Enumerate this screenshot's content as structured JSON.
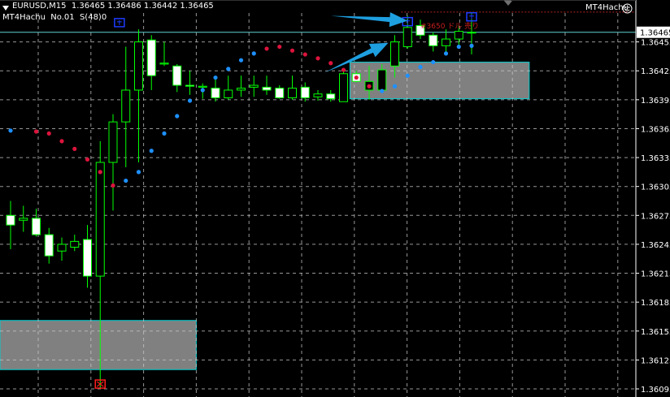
{
  "header": {
    "symbol_line": "EURUSD,M15  1.36465 1.36486 1.36442 1.36465",
    "indicator_line": "MT4Hachu  No.01  S(48)0",
    "ea_label": "MT4Hachu",
    "smiley_icon": "smiley-icon",
    "dropdown_icon": "triangle-down-icon"
  },
  "order_annotation": "#3650 ドル 売り",
  "colors": {
    "background": "#000000",
    "grid": "#c8c8c8",
    "axis": "#ffffff",
    "bull_candle": "#000000",
    "bear_candle": "#ffffff",
    "candle_outline": "#00ff00",
    "sar_up": "#1e90ff",
    "sar_down": "#dc143c",
    "zone_fill": "#808080",
    "zone_border": "#00ced1",
    "arrow": "#1e9fe0",
    "price_line": "#5fd3d3",
    "marker_blue": "#1e3cff",
    "marker_red": "#ff1e1e",
    "price_tag_bg": "#ffffff"
  },
  "chart_data": {
    "type": "candlestick",
    "title": "EURUSD,M15",
    "ylim": [
      1.36095,
      1.36485
    ],
    "grid": true,
    "yticks": [
      "1.36095",
      "1.36125",
      "1.36155",
      "1.36185",
      "1.36215",
      "1.36245",
      "1.36275",
      "1.36305",
      "1.36335",
      "1.36365",
      "1.36395",
      "1.36425",
      "1.36455"
    ],
    "current_price": "1.36465",
    "candles": [
      {
        "o": 1.36275,
        "h": 1.3629,
        "l": 1.3624,
        "c": 1.36265
      },
      {
        "o": 1.3627,
        "h": 1.36285,
        "l": 1.36258,
        "c": 1.36272
      },
      {
        "o": 1.36272,
        "h": 1.36282,
        "l": 1.36253,
        "c": 1.36255
      },
      {
        "o": 1.36255,
        "h": 1.36262,
        "l": 1.36225,
        "c": 1.36233
      },
      {
        "o": 1.36238,
        "h": 1.36252,
        "l": 1.36228,
        "c": 1.36245
      },
      {
        "o": 1.36242,
        "h": 1.36255,
        "l": 1.36238,
        "c": 1.36248
      },
      {
        "o": 1.3625,
        "h": 1.36265,
        "l": 1.362,
        "c": 1.36212
      },
      {
        "o": 1.36212,
        "h": 1.36352,
        "l": 1.36095,
        "c": 1.3633
      },
      {
        "o": 1.3633,
        "h": 1.3638,
        "l": 1.3628,
        "c": 1.36372
      },
      {
        "o": 1.36372,
        "h": 1.3645,
        "l": 1.36325,
        "c": 1.36405
      },
      {
        "o": 1.36405,
        "h": 1.36468,
        "l": 1.3633,
        "c": 1.36455
      },
      {
        "o": 1.36457,
        "h": 1.36462,
        "l": 1.36405,
        "c": 1.3642
      },
      {
        "o": 1.36432,
        "h": 1.36455,
        "l": 1.3643,
        "c": 1.36433
      },
      {
        "o": 1.3643,
        "h": 1.36432,
        "l": 1.36403,
        "c": 1.3641
      },
      {
        "o": 1.3641,
        "h": 1.36425,
        "l": 1.364,
        "c": 1.36409
      },
      {
        "o": 1.36408,
        "h": 1.36412,
        "l": 1.36396,
        "c": 1.36409
      },
      {
        "o": 1.36407,
        "h": 1.36418,
        "l": 1.36393,
        "c": 1.36397
      },
      {
        "o": 1.36397,
        "h": 1.3642,
        "l": 1.36395,
        "c": 1.36405
      },
      {
        "o": 1.36405,
        "h": 1.3642,
        "l": 1.36398,
        "c": 1.36407
      },
      {
        "o": 1.36408,
        "h": 1.3642,
        "l": 1.36398,
        "c": 1.3641
      },
      {
        "o": 1.36408,
        "h": 1.3642,
        "l": 1.364,
        "c": 1.36405
      },
      {
        "o": 1.36407,
        "h": 1.3641,
        "l": 1.36396,
        "c": 1.36397
      },
      {
        "o": 1.36397,
        "h": 1.3642,
        "l": 1.36395,
        "c": 1.36407
      },
      {
        "o": 1.36408,
        "h": 1.36413,
        "l": 1.36393,
        "c": 1.36397
      },
      {
        "o": 1.36398,
        "h": 1.36405,
        "l": 1.36394,
        "c": 1.36401
      },
      {
        "o": 1.36401,
        "h": 1.36405,
        "l": 1.36393,
        "c": 1.36396
      },
      {
        "o": 1.36393,
        "h": 1.36426,
        "l": 1.36393,
        "c": 1.36422
      },
      {
        "o": 1.36422,
        "h": 1.36425,
        "l": 1.36413,
        "c": 1.36414
      },
      {
        "o": 1.36405,
        "h": 1.3643,
        "l": 1.36395,
        "c": 1.36414
      },
      {
        "o": 1.36405,
        "h": 1.36432,
        "l": 1.36402,
        "c": 1.36426
      },
      {
        "o": 1.3643,
        "h": 1.36462,
        "l": 1.36418,
        "c": 1.36455
      },
      {
        "o": 1.3645,
        "h": 1.36482,
        "l": 1.36448,
        "c": 1.3647
      },
      {
        "o": 1.36472,
        "h": 1.36478,
        "l": 1.36458,
        "c": 1.36462
      },
      {
        "o": 1.36462,
        "h": 1.36465,
        "l": 1.36445,
        "c": 1.36451
      },
      {
        "o": 1.36451,
        "h": 1.36468,
        "l": 1.36442,
        "c": 1.36458
      },
      {
        "o": 1.36458,
        "h": 1.36472,
        "l": 1.36448,
        "c": 1.36466
      },
      {
        "o": 1.36465,
        "h": 1.36486,
        "l": 1.36442,
        "c": 1.36465
      }
    ],
    "sar": [
      {
        "i": 0,
        "v": 1.36363,
        "side": "below"
      },
      {
        "i": 2,
        "v": 1.36362,
        "side": "above"
      },
      {
        "i": 3,
        "v": 1.3636,
        "side": "above"
      },
      {
        "i": 4,
        "v": 1.36352,
        "side": "above"
      },
      {
        "i": 5,
        "v": 1.36344,
        "side": "above"
      },
      {
        "i": 6,
        "v": 1.36333,
        "side": "above"
      },
      {
        "i": 7,
        "v": 1.3632,
        "side": "above"
      },
      {
        "i": 8,
        "v": 1.36306,
        "side": "above"
      },
      {
        "i": 9,
        "v": 1.36311,
        "side": "below"
      },
      {
        "i": 10,
        "v": 1.3632,
        "side": "below"
      },
      {
        "i": 11,
        "v": 1.36342,
        "side": "below"
      },
      {
        "i": 12,
        "v": 1.3636,
        "side": "below"
      },
      {
        "i": 13,
        "v": 1.36378,
        "side": "below"
      },
      {
        "i": 14,
        "v": 1.36394,
        "side": "below"
      },
      {
        "i": 15,
        "v": 1.36405,
        "side": "below"
      },
      {
        "i": 16,
        "v": 1.36418,
        "side": "below"
      },
      {
        "i": 17,
        "v": 1.36427,
        "side": "below"
      },
      {
        "i": 18,
        "v": 1.36436,
        "side": "below"
      },
      {
        "i": 19,
        "v": 1.36443,
        "side": "below"
      },
      {
        "i": 20,
        "v": 1.36448,
        "side": "above"
      },
      {
        "i": 21,
        "v": 1.3645,
        "side": "above"
      },
      {
        "i": 22,
        "v": 1.36446,
        "side": "above"
      },
      {
        "i": 23,
        "v": 1.36442,
        "side": "above"
      },
      {
        "i": 24,
        "v": 1.36438,
        "side": "above"
      },
      {
        "i": 25,
        "v": 1.36433,
        "side": "above"
      },
      {
        "i": 26,
        "v": 1.36426,
        "side": "above"
      },
      {
        "i": 27,
        "v": 1.36418,
        "side": "above"
      },
      {
        "i": 28,
        "v": 1.36409,
        "side": "above"
      },
      {
        "i": 29,
        "v": 1.36404,
        "side": "below"
      },
      {
        "i": 30,
        "v": 1.36409,
        "side": "below"
      },
      {
        "i": 31,
        "v": 1.3642,
        "side": "below"
      },
      {
        "i": 32,
        "v": 1.36429,
        "side": "below"
      },
      {
        "i": 33,
        "v": 1.36434,
        "side": "below"
      },
      {
        "i": 34,
        "v": 1.36443,
        "side": "below"
      },
      {
        "i": 35,
        "v": 1.3645,
        "side": "below"
      },
      {
        "i": 36,
        "v": 1.36451,
        "side": "below"
      }
    ],
    "zones": [
      {
        "from_index": -1,
        "to_index": 14,
        "top": 1.36166,
        "bottom": 1.36115
      },
      {
        "from_index": 27,
        "to_index": 40,
        "top": 1.36434,
        "bottom": 1.36396
      }
    ],
    "markers": [
      {
        "type": "box",
        "color": "blue",
        "index": 8.5,
        "price": 1.36475
      },
      {
        "type": "box",
        "color": "blue",
        "index": 31,
        "price": 1.36476
      },
      {
        "type": "box",
        "color": "blue",
        "index": 36,
        "price": 1.36481
      },
      {
        "type": "box-x",
        "color": "red",
        "index": 7,
        "price": 1.361
      }
    ],
    "price_lines": [
      {
        "price": 1.36465,
        "color": "cyan"
      },
      {
        "price": 1.36486,
        "color": "red",
        "dotted": true,
        "from_index": 31
      }
    ],
    "arrows": [
      {
        "from_index": 25,
        "from_price": 1.36482,
        "to_index": 31,
        "to_price": 1.36477
      },
      {
        "from_index": 24.5,
        "from_price": 1.36423,
        "to_index": 29.5,
        "to_price": 1.36454
      }
    ]
  }
}
